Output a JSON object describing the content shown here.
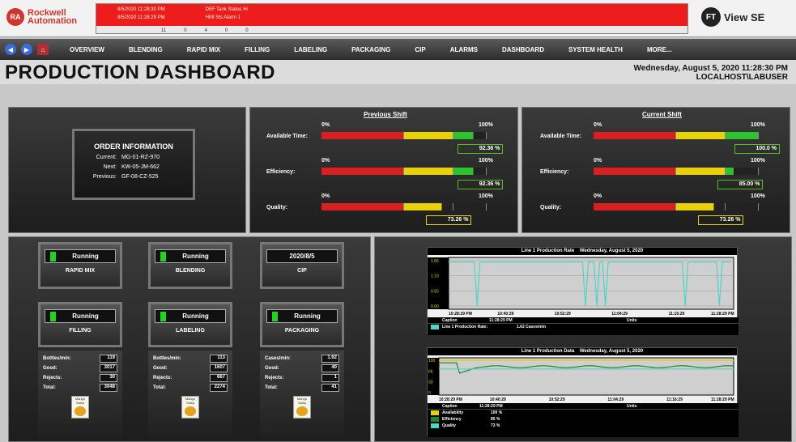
{
  "header": {
    "logo_line1": "Rockwell",
    "logo_line2": "Automation",
    "logo_mark": "RA",
    "alarm_banner": {
      "rows": [
        {
          "time": "8/5/2020 11:28:30 PM",
          "text": "DEF Tank Status",
          "value": "Hi"
        },
        {
          "time": "8/5/2020 11:28:29 PM",
          "text": "HMI Sts Alarm",
          "value": "1"
        }
      ],
      "counts": [
        "11",
        "0",
        "4",
        "0",
        "0"
      ]
    },
    "product_mark": "FT",
    "product_name": "View SE"
  },
  "nav": {
    "items": [
      "OVERVIEW",
      "BLENDING",
      "RAPID MIX",
      "FILLING",
      "LABELING",
      "PACKAGING",
      "CIP",
      "ALARMS",
      "DASHBOARD",
      "SYSTEM HEALTH",
      "MORE..."
    ]
  },
  "page": {
    "title": "PRODUCTION DASHBOARD",
    "datetime": "Wednesday, August 5, 2020 11:28:30 PM",
    "user": "LOCALHOST\\LABUSER"
  },
  "order": {
    "title": "ORDER INFORMATION",
    "rows": [
      {
        "label": "Current:",
        "value": "MG-01-RZ-970"
      },
      {
        "label": "Next:",
        "value": "KW-05-JM-662"
      },
      {
        "label": "Previous:",
        "value": "GF-08-CZ-525"
      }
    ]
  },
  "previous_shift": {
    "title": "Previous Shift",
    "meters": [
      {
        "label": "Available Time:",
        "value": 92.36,
        "text": "92.36 %"
      },
      {
        "label": "Efficiency:",
        "value": 92.36,
        "text": "92.36 %"
      },
      {
        "label": "Quality:",
        "value": 73.26,
        "text": "73.26 %"
      }
    ],
    "min": "0%",
    "max": "100%"
  },
  "current_shift": {
    "title": "Current Shift",
    "meters": [
      {
        "label": "Available Time:",
        "value": 100.0,
        "text": "100.0 %"
      },
      {
        "label": "Efficiency:",
        "value": 85.0,
        "text": "85.00 %"
      },
      {
        "label": "Quality:",
        "value": 73.26,
        "text": "73.26 %"
      }
    ],
    "min": "0%",
    "max": "100%"
  },
  "units_top": [
    {
      "status": "Running",
      "name": "RAPID MIX",
      "led": true
    },
    {
      "status": "Running",
      "name": "BLENDING",
      "led": true
    },
    {
      "status": "2020/8/5",
      "name": "CIP",
      "led": false
    }
  ],
  "units_bottom": [
    {
      "status": "Running",
      "name": "FILLING",
      "rows": [
        {
          "label": "Bottles/min:",
          "value": "119"
        },
        {
          "label": "Good:",
          "value": "3017"
        },
        {
          "label": "Rejects:",
          "value": "30"
        },
        {
          "label": "Total:",
          "value": "3048"
        }
      ]
    },
    {
      "status": "Running",
      "name": "LABELING",
      "rows": [
        {
          "label": "Bottles/min:",
          "value": "113"
        },
        {
          "label": "Good:",
          "value": "1607"
        },
        {
          "label": "Rejects:",
          "value": "667"
        },
        {
          "label": "Total:",
          "value": "2274"
        }
      ]
    },
    {
      "status": "Running",
      "name": "PACKAGING",
      "rows": [
        {
          "label": "Cases/min:",
          "value": "1.62"
        },
        {
          "label": "Good:",
          "value": "40"
        },
        {
          "label": "Rejects:",
          "value": "1"
        },
        {
          "label": "Total:",
          "value": "41"
        }
      ]
    }
  ],
  "product_label": "Mango Salsa",
  "trend1": {
    "title": "Line 1 Production Rate",
    "date": "Wednesday, August 5, 2020",
    "yticks": [
      "1.65",
      "1.10",
      "0.55",
      "0.00"
    ],
    "xticks": [
      "10:28:29 PM",
      "10:40:29",
      "10:52:29",
      "11:04:29",
      "11:16:29",
      "11:28:29 PM"
    ],
    "legend_header": [
      "Caption",
      "11:28:29 PM",
      "Units"
    ],
    "legend": [
      {
        "caption": "Line 1 Production Rate:",
        "value": "1.62 Cases/min",
        "color": "#4fd4c8"
      }
    ]
  },
  "trend2": {
    "title": "Line 1 Production Data",
    "date": "Wednesday, August 5, 2020",
    "yticks": [
      "100",
      "66",
      "33",
      "0"
    ],
    "xticks": [
      "10:28:29 PM",
      "10:40:29",
      "10:52:29",
      "11:04:29",
      "11:16:29",
      "11:28:29 PM"
    ],
    "legend_header": [
      "Caption",
      "11:28:29 PM",
      "Units"
    ],
    "legend": [
      {
        "caption": "Availability",
        "value": "100 %",
        "color": "#e8d00a"
      },
      {
        "caption": "Efficiency",
        "value": "85 %",
        "color": "#1a8a2a"
      },
      {
        "caption": "Quality",
        "value": "73 %",
        "color": "#4fd4c8"
      }
    ]
  }
}
